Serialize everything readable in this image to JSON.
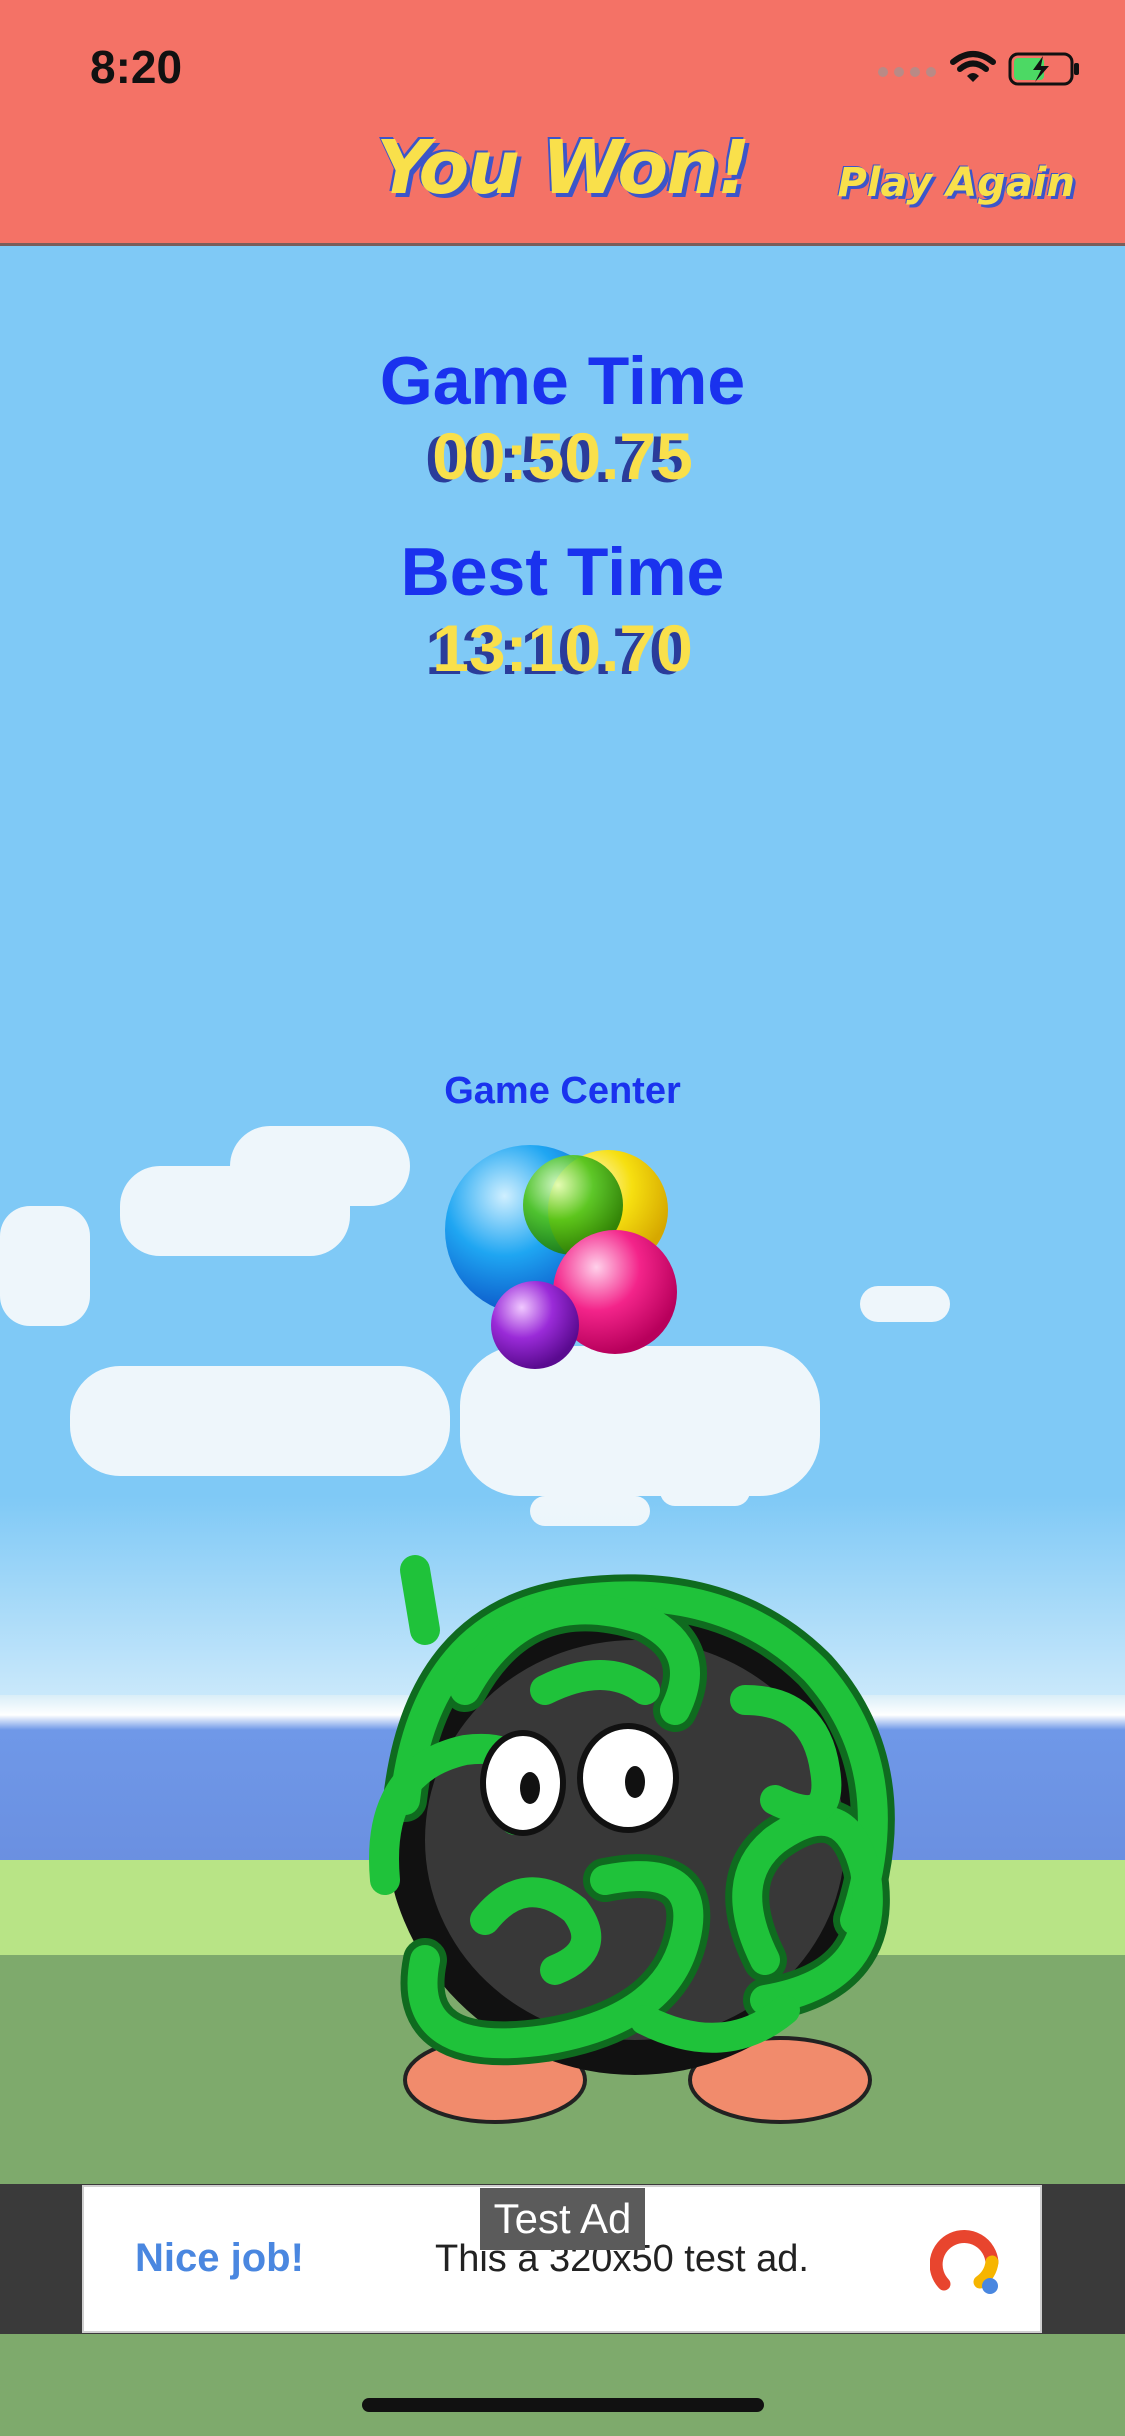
{
  "status_bar": {
    "time": "8:20"
  },
  "header": {
    "title": "You Won!",
    "play_again": "Play Again"
  },
  "scores": {
    "game_time_label": "Game Time",
    "game_time_value": "00:50.75",
    "best_time_label": "Best Time",
    "best_time_value": "13:10.70"
  },
  "game_center": {
    "label": "Game Center",
    "icon": "game-center-icon"
  },
  "ad": {
    "tag": "Test Ad",
    "headline": "Nice job!",
    "body": "This a 320x50 test ad.",
    "icon": "admob-logo-icon"
  },
  "colors": {
    "header_bg": "#f47266",
    "sky": "#7fc9f6",
    "label_blue": "#1a32ee",
    "value_yellow": "#f9e04b"
  }
}
